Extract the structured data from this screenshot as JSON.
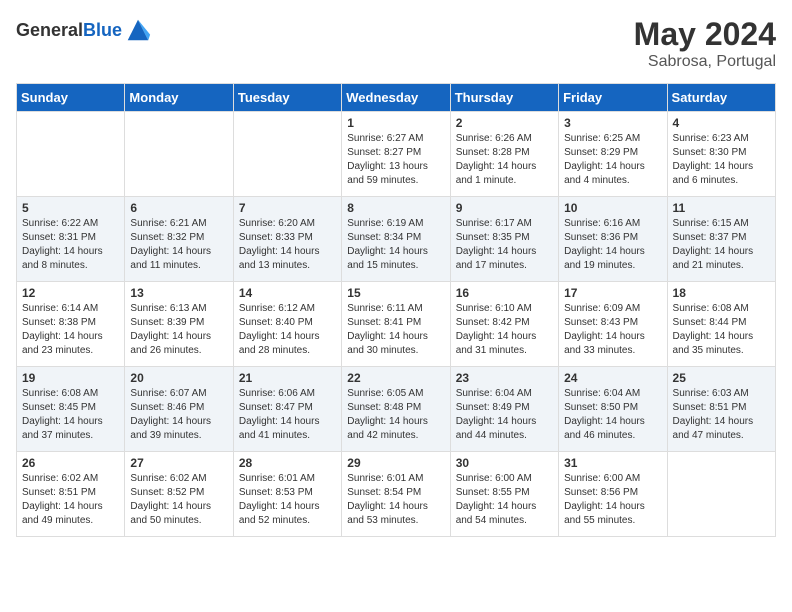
{
  "header": {
    "logo_general": "General",
    "logo_blue": "Blue",
    "month_title": "May 2024",
    "subtitle": "Sabrosa, Portugal"
  },
  "days_of_week": [
    "Sunday",
    "Monday",
    "Tuesday",
    "Wednesday",
    "Thursday",
    "Friday",
    "Saturday"
  ],
  "weeks": [
    [
      {
        "day": "",
        "sunrise": "",
        "sunset": "",
        "daylight": ""
      },
      {
        "day": "",
        "sunrise": "",
        "sunset": "",
        "daylight": ""
      },
      {
        "day": "",
        "sunrise": "",
        "sunset": "",
        "daylight": ""
      },
      {
        "day": "1",
        "sunrise": "6:27 AM",
        "sunset": "8:27 PM",
        "daylight": "13 hours and 59 minutes."
      },
      {
        "day": "2",
        "sunrise": "6:26 AM",
        "sunset": "8:28 PM",
        "daylight": "14 hours and 1 minute."
      },
      {
        "day": "3",
        "sunrise": "6:25 AM",
        "sunset": "8:29 PM",
        "daylight": "14 hours and 4 minutes."
      },
      {
        "day": "4",
        "sunrise": "6:23 AM",
        "sunset": "8:30 PM",
        "daylight": "14 hours and 6 minutes."
      }
    ],
    [
      {
        "day": "5",
        "sunrise": "6:22 AM",
        "sunset": "8:31 PM",
        "daylight": "14 hours and 8 minutes."
      },
      {
        "day": "6",
        "sunrise": "6:21 AM",
        "sunset": "8:32 PM",
        "daylight": "14 hours and 11 minutes."
      },
      {
        "day": "7",
        "sunrise": "6:20 AM",
        "sunset": "8:33 PM",
        "daylight": "14 hours and 13 minutes."
      },
      {
        "day": "8",
        "sunrise": "6:19 AM",
        "sunset": "8:34 PM",
        "daylight": "14 hours and 15 minutes."
      },
      {
        "day": "9",
        "sunrise": "6:17 AM",
        "sunset": "8:35 PM",
        "daylight": "14 hours and 17 minutes."
      },
      {
        "day": "10",
        "sunrise": "6:16 AM",
        "sunset": "8:36 PM",
        "daylight": "14 hours and 19 minutes."
      },
      {
        "day": "11",
        "sunrise": "6:15 AM",
        "sunset": "8:37 PM",
        "daylight": "14 hours and 21 minutes."
      }
    ],
    [
      {
        "day": "12",
        "sunrise": "6:14 AM",
        "sunset": "8:38 PM",
        "daylight": "14 hours and 23 minutes."
      },
      {
        "day": "13",
        "sunrise": "6:13 AM",
        "sunset": "8:39 PM",
        "daylight": "14 hours and 26 minutes."
      },
      {
        "day": "14",
        "sunrise": "6:12 AM",
        "sunset": "8:40 PM",
        "daylight": "14 hours and 28 minutes."
      },
      {
        "day": "15",
        "sunrise": "6:11 AM",
        "sunset": "8:41 PM",
        "daylight": "14 hours and 30 minutes."
      },
      {
        "day": "16",
        "sunrise": "6:10 AM",
        "sunset": "8:42 PM",
        "daylight": "14 hours and 31 minutes."
      },
      {
        "day": "17",
        "sunrise": "6:09 AM",
        "sunset": "8:43 PM",
        "daylight": "14 hours and 33 minutes."
      },
      {
        "day": "18",
        "sunrise": "6:08 AM",
        "sunset": "8:44 PM",
        "daylight": "14 hours and 35 minutes."
      }
    ],
    [
      {
        "day": "19",
        "sunrise": "6:08 AM",
        "sunset": "8:45 PM",
        "daylight": "14 hours and 37 minutes."
      },
      {
        "day": "20",
        "sunrise": "6:07 AM",
        "sunset": "8:46 PM",
        "daylight": "14 hours and 39 minutes."
      },
      {
        "day": "21",
        "sunrise": "6:06 AM",
        "sunset": "8:47 PM",
        "daylight": "14 hours and 41 minutes."
      },
      {
        "day": "22",
        "sunrise": "6:05 AM",
        "sunset": "8:48 PM",
        "daylight": "14 hours and 42 minutes."
      },
      {
        "day": "23",
        "sunrise": "6:04 AM",
        "sunset": "8:49 PM",
        "daylight": "14 hours and 44 minutes."
      },
      {
        "day": "24",
        "sunrise": "6:04 AM",
        "sunset": "8:50 PM",
        "daylight": "14 hours and 46 minutes."
      },
      {
        "day": "25",
        "sunrise": "6:03 AM",
        "sunset": "8:51 PM",
        "daylight": "14 hours and 47 minutes."
      }
    ],
    [
      {
        "day": "26",
        "sunrise": "6:02 AM",
        "sunset": "8:51 PM",
        "daylight": "14 hours and 49 minutes."
      },
      {
        "day": "27",
        "sunrise": "6:02 AM",
        "sunset": "8:52 PM",
        "daylight": "14 hours and 50 minutes."
      },
      {
        "day": "28",
        "sunrise": "6:01 AM",
        "sunset": "8:53 PM",
        "daylight": "14 hours and 52 minutes."
      },
      {
        "day": "29",
        "sunrise": "6:01 AM",
        "sunset": "8:54 PM",
        "daylight": "14 hours and 53 minutes."
      },
      {
        "day": "30",
        "sunrise": "6:00 AM",
        "sunset": "8:55 PM",
        "daylight": "14 hours and 54 minutes."
      },
      {
        "day": "31",
        "sunrise": "6:00 AM",
        "sunset": "8:56 PM",
        "daylight": "14 hours and 55 minutes."
      },
      {
        "day": "",
        "sunrise": "",
        "sunset": "",
        "daylight": ""
      }
    ]
  ]
}
